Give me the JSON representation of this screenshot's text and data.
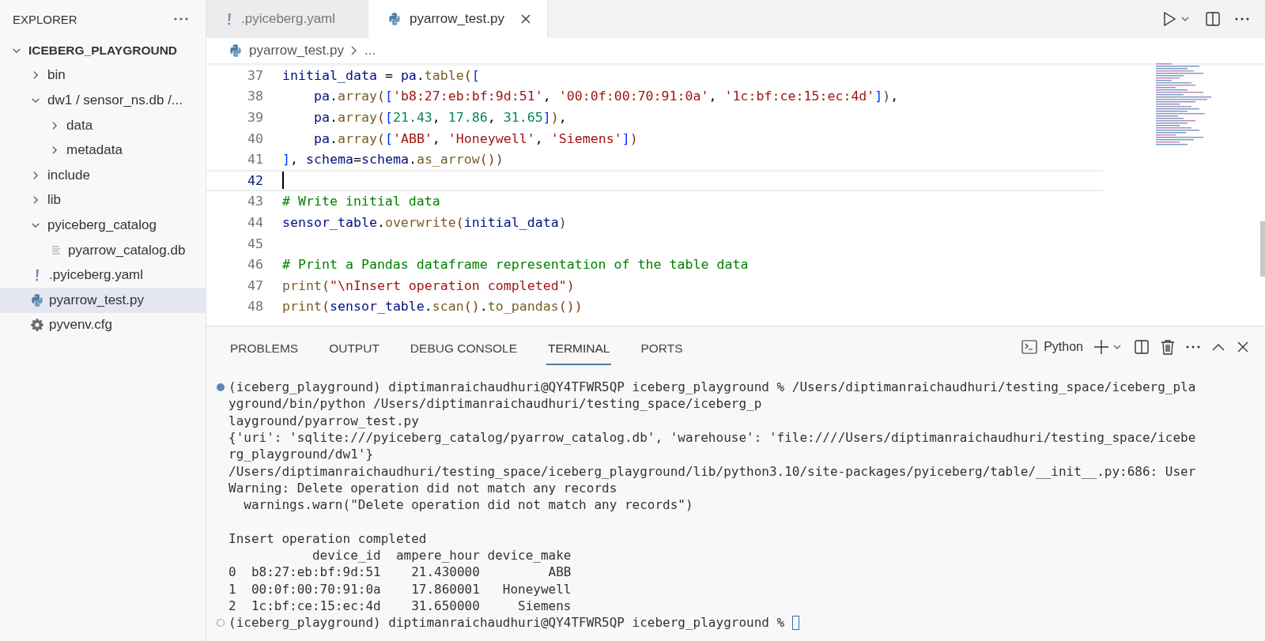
{
  "sidebar": {
    "title": "EXPLORER",
    "tree": [
      {
        "label": "ICEBERG_PLAYGROUND",
        "kind": "root",
        "expanded": true,
        "selected": false,
        "children": [
          {
            "label": "bin",
            "kind": "folder",
            "expanded": false,
            "selected": false
          },
          {
            "label": "dw1 / sensor_ns.db /...",
            "kind": "folder",
            "expanded": true,
            "selected": false,
            "children": [
              {
                "label": "data",
                "kind": "folder",
                "expanded": false,
                "selected": false
              },
              {
                "label": "metadata",
                "kind": "folder",
                "expanded": false,
                "selected": false
              }
            ]
          },
          {
            "label": "include",
            "kind": "folder",
            "expanded": false,
            "selected": false
          },
          {
            "label": "lib",
            "kind": "folder",
            "expanded": false,
            "selected": false
          },
          {
            "label": "pyiceberg_catalog",
            "kind": "folder",
            "expanded": true,
            "selected": false,
            "children": [
              {
                "label": "pyarrow_catalog.db",
                "kind": "file",
                "selected": false
              }
            ]
          },
          {
            "label": ".pyiceberg.yaml",
            "kind": "yaml",
            "selected": false
          },
          {
            "label": "pyarrow_test.py",
            "kind": "python",
            "selected": true
          },
          {
            "label": "pyvenv.cfg",
            "kind": "config",
            "selected": false
          }
        ]
      }
    ]
  },
  "tabs": [
    {
      "label": ".pyiceberg.yaml",
      "kind": "yaml",
      "selected": false
    },
    {
      "label": "pyarrow_test.py",
      "kind": "python",
      "selected": true
    }
  ],
  "breadcrumb": {
    "file": "pyarrow_test.py",
    "rest": "..."
  },
  "editor": {
    "lines": [
      {
        "number": "37",
        "current": false,
        "code": "initial_data = pa.table(["
      },
      {
        "number": "38",
        "current": false,
        "code": "    pa.array(['b8:27:eb:bf:9d:51', '00:0f:00:70:91:0a', '1c:bf:ce:15:ec:4d']),"
      },
      {
        "number": "39",
        "current": false,
        "code": "    pa.array([21.43, 17.86, 31.65]),"
      },
      {
        "number": "40",
        "current": false,
        "code": "    pa.array(['ABB', 'Honeywell', 'Siemens'])"
      },
      {
        "number": "41",
        "current": false,
        "code": "], schema=schema.as_arrow())"
      },
      {
        "number": "42",
        "current": true
      },
      {
        "number": "43",
        "current": false,
        "code": "# Write initial data"
      },
      {
        "number": "44",
        "current": false,
        "code": "sensor_table.overwrite(initial_data)"
      },
      {
        "number": "45",
        "current": false
      },
      {
        "number": "46",
        "current": false,
        "code": "# Print a Pandas dataframe representation of the table data"
      },
      {
        "number": "47",
        "current": false,
        "code": "print(\"\\nInsert operation completed\")"
      },
      {
        "number": "48",
        "current": false,
        "code": "print(sensor_table.scan().to_pandas())"
      }
    ]
  },
  "panel": {
    "tabs": [
      {
        "label": "PROBLEMS",
        "selected": false
      },
      {
        "label": "OUTPUT",
        "selected": false
      },
      {
        "label": "DEBUG CONSOLE",
        "selected": false
      },
      {
        "label": "TERMINAL",
        "selected": true
      },
      {
        "label": "PORTS",
        "selected": false
      }
    ],
    "terminal_name": "Python",
    "terminal": {
      "cursor": true,
      "lines": [
        {
          "kind": "finished-command",
          "text": "(iceberg_playground) diptimanraichaudhuri@QY4TFWR5QP iceberg_playground % /Users/diptimanraichaudhuri/testing_space/iceberg_pla"
        },
        {
          "kind": "output",
          "text": "yground/bin/python /Users/diptimanraichaudhuri/testing_space/iceberg_p"
        },
        {
          "kind": "output",
          "text": "layground/pyarrow_test.py"
        },
        {
          "kind": "output",
          "text": "{'uri': 'sqlite:///pyiceberg_catalog/pyarrow_catalog.db', 'warehouse': 'file:////Users/diptimanraichaudhuri/testing_space/icebe"
        },
        {
          "kind": "output",
          "text": "rg_playground/dw1'}"
        },
        {
          "kind": "output",
          "text": "/Users/diptimanraichaudhuri/testing_space/iceberg_playground/lib/python3.10/site-packages/pyiceberg/table/__init__.py:686: User"
        },
        {
          "kind": "output",
          "text": "Warning: Delete operation did not match any records"
        },
        {
          "kind": "output",
          "text": "  warnings.warn(\"Delete operation did not match any records\")"
        },
        {
          "kind": "blank"
        },
        {
          "kind": "output",
          "text": "Insert operation completed"
        },
        {
          "kind": "output",
          "text": "           device_id  ampere_hour device_make"
        },
        {
          "kind": "output",
          "text": "0  b8:27:eb:bf:9d:51    21.430000         ABB"
        },
        {
          "kind": "output",
          "text": "1  00:0f:00:70:91:0a    17.860001   Honeywell"
        },
        {
          "kind": "output",
          "text": "2  1c:bf:ce:15:ec:4d    31.650000     Siemens"
        },
        {
          "kind": "pending-command",
          "text": "(iceberg_playground) diptimanraichaudhuri@QY4TFWR5QP iceberg_playground %"
        }
      ]
    }
  }
}
